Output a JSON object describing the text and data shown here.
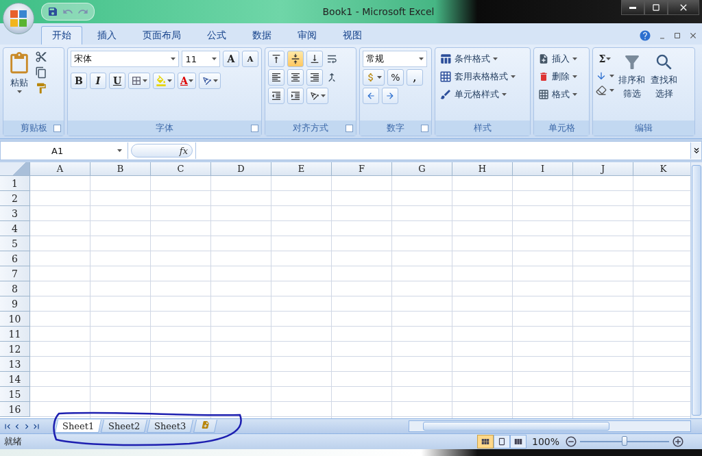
{
  "window": {
    "title": "Book1 - Microsoft Excel"
  },
  "ribbon_tabs": [
    {
      "label": "开始",
      "selected": true
    },
    {
      "label": "插入",
      "selected": false
    },
    {
      "label": "页面布局",
      "selected": false
    },
    {
      "label": "公式",
      "selected": false
    },
    {
      "label": "数据",
      "selected": false
    },
    {
      "label": "审阅",
      "selected": false
    },
    {
      "label": "视图",
      "selected": false
    }
  ],
  "ribbon": {
    "clipboard": {
      "label": "剪贴板",
      "paste": "粘贴"
    },
    "font": {
      "label": "字体",
      "font_name": "宋体",
      "font_size": "11",
      "grow": "A",
      "shrink": "A",
      "bold": "B",
      "italic": "I",
      "underline": "U",
      "font_color": "A"
    },
    "alignment": {
      "label": "对齐方式",
      "vertical": [
        {
          "kind": "top",
          "selected": false
        },
        {
          "kind": "middle",
          "selected": true
        },
        {
          "kind": "bottom",
          "selected": false
        }
      ],
      "horizontal": [
        {
          "kind": "left",
          "selected": false
        },
        {
          "kind": "center",
          "selected": false
        },
        {
          "kind": "right",
          "selected": false
        }
      ]
    },
    "number": {
      "label": "数字",
      "format": "常规",
      "percent": "%",
      "comma": ","
    },
    "styles": {
      "label": "样式",
      "items": [
        "条件格式",
        "套用表格格式",
        "单元格样式"
      ]
    },
    "cells": {
      "label": "单元格",
      "items": [
        "插入",
        "删除",
        "格式"
      ]
    },
    "editing": {
      "label": "编辑",
      "sum": "Σ",
      "sort_filter": [
        "排序和",
        "筛选"
      ],
      "find_select": [
        "查找和",
        "选择"
      ]
    }
  },
  "formula_bar": {
    "name_box": "A1",
    "fx": "fx"
  },
  "sheet": {
    "columns": [
      "A",
      "B",
      "C",
      "D",
      "E",
      "F",
      "G",
      "H",
      "I",
      "J",
      "K"
    ],
    "rows": [
      "1",
      "2",
      "3",
      "4",
      "5",
      "6",
      "7",
      "8",
      "9",
      "10",
      "11",
      "12",
      "13",
      "14",
      "15",
      "16"
    ]
  },
  "sheet_tabs": [
    {
      "label": "Sheet1",
      "selected": true
    },
    {
      "label": "Sheet2",
      "selected": false
    },
    {
      "label": "Sheet3",
      "selected": false
    }
  ],
  "status_bar": {
    "status": "就绪",
    "view_modes": [
      {
        "kind": "normal",
        "selected": true
      },
      {
        "kind": "page_layout",
        "selected": false
      },
      {
        "kind": "page_break",
        "selected": false
      }
    ],
    "zoom": "100%",
    "zoom_slider": {
      "level": 0.5
    }
  }
}
